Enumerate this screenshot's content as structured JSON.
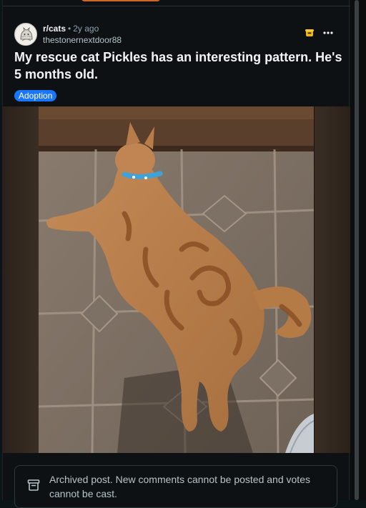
{
  "post": {
    "subreddit": "r/cats",
    "separator": "•",
    "age": "2y ago",
    "author": "thestonernextdoor88",
    "title": "My rescue cat Pickles has an interesting pattern. He's 5 months old.",
    "flair": "Adoption",
    "more_label": "•••"
  },
  "archived": {
    "message": "Archived post. New comments cannot be posted and votes cannot be cast."
  },
  "icons": {
    "join": "joined-community-icon",
    "more": "more-options-icon",
    "archive": "archive-box-icon"
  },
  "colors": {
    "accent_orange": "#f0752a",
    "flair_blue": "#1a75ff",
    "background": "#0e1113"
  }
}
